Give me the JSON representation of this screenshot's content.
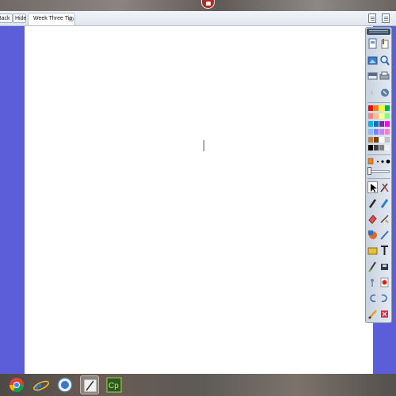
{
  "browser": {
    "back_label": "Back",
    "hide_label": "Hide",
    "tab_title": "Week Three Tip",
    "tab_close_glyph": "x"
  },
  "desktop": {
    "top_icon": "app-icon",
    "taskbar_icons": [
      "chrome-icon",
      "internet-explorer-icon",
      "screen-recorder-icon",
      "whiteboard-app-icon",
      "captivate-icon"
    ],
    "captivate_label": "Cp"
  },
  "toolbar": {
    "tools": [
      "page-sorter-icon",
      "attachments-icon",
      "gallery-icon",
      "zoom-icon",
      "screen-shade-icon",
      "print-icon",
      "undo-icon",
      "redo-icon",
      "select-icon",
      "magic-pen-icon",
      "pen-icon",
      "highlighter-icon",
      "eraser-icon",
      "line-icon",
      "shapes-icon",
      "fill-icon",
      "text-icon",
      "table-icon",
      "marker-icon",
      "camera-icon",
      "pointer-icon",
      "record-icon",
      "rotate-left-icon",
      "rotate-right-icon",
      "pencil-icon",
      "color-picker-icon"
    ],
    "palette": [
      "#ff0000",
      "#ff8000",
      "#ffff00",
      "#00b050",
      "#ff8080",
      "#ffc080",
      "#ffff80",
      "#80ff80",
      "#00b0f0",
      "#0070c0",
      "#7030a0",
      "#ff00ff",
      "#80c0ff",
      "#8080ff",
      "#c080ff",
      "#ff80c0",
      "#c08040",
      "#804000",
      "#ffffff",
      "#c0c0c0",
      "#000000",
      "#404040",
      "#808080",
      "#f0f0f0"
    ],
    "accent": "#ff8000"
  },
  "colors": {
    "side_background": "#5b5ed8",
    "canvas": "#ffffff"
  }
}
